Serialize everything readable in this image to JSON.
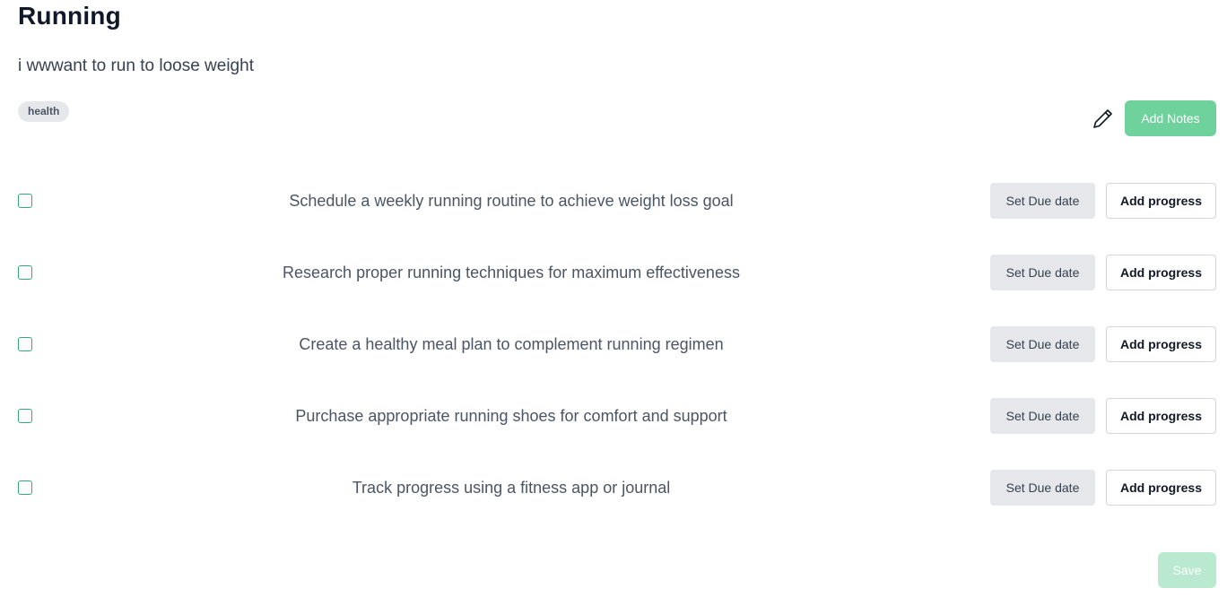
{
  "goal": {
    "title": "Running",
    "description": "i wwwant to run to loose weight",
    "tag": "health"
  },
  "toolbar": {
    "edit_icon": "pencil-icon",
    "add_notes_label": "Add Notes"
  },
  "tasks": [
    {
      "text": "Schedule a weekly running routine to achieve weight loss goal",
      "checked": false,
      "due_label": "Set Due date",
      "progress_label": "Add progress"
    },
    {
      "text": "Research proper running techniques for maximum effectiveness",
      "checked": false,
      "due_label": "Set Due date",
      "progress_label": "Add progress"
    },
    {
      "text": "Create a healthy meal plan to complement running regimen",
      "checked": false,
      "due_label": "Set Due date",
      "progress_label": "Add progress"
    },
    {
      "text": "Purchase appropriate running shoes for comfort and support",
      "checked": false,
      "due_label": "Set Due date",
      "progress_label": "Add progress"
    },
    {
      "text": "Track progress using a fitness app or journal",
      "checked": false,
      "due_label": "Set Due date",
      "progress_label": "Add progress"
    }
  ],
  "footer": {
    "save_label": "Save"
  },
  "colors": {
    "accent": "#6fd19c",
    "accent_disabled": "#b9ead0",
    "checkbox_border": "#34a77a"
  }
}
